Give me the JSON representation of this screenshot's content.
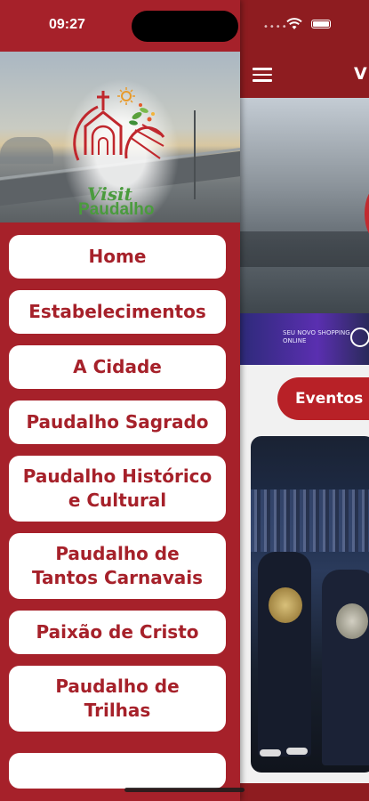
{
  "status": {
    "time": "09:27"
  },
  "background": {
    "header_title": "V",
    "ad_text": "SEU NOVO SHOPPING ONLINE",
    "events_pill": "Eventos"
  },
  "drawer": {
    "logo": {
      "visit": "Visit",
      "place": "Paudalho"
    },
    "menu": [
      {
        "lines": [
          "Home"
        ]
      },
      {
        "lines": [
          "Estabelecimentos"
        ]
      },
      {
        "lines": [
          "A Cidade"
        ]
      },
      {
        "lines": [
          "Paudalho Sagrado"
        ]
      },
      {
        "lines": [
          "Paudalho Histórico",
          "e Cultural"
        ]
      },
      {
        "lines": [
          "Paudalho de",
          "Tantos Carnavais"
        ]
      },
      {
        "lines": [
          "Paixão de Cristo"
        ]
      },
      {
        "lines": [
          "Paudalho de",
          "Trilhas"
        ]
      }
    ]
  },
  "colors": {
    "drawer_red": "#a6212a",
    "menu_text": "#a6212a",
    "logo_green": "#4a9b3d"
  }
}
